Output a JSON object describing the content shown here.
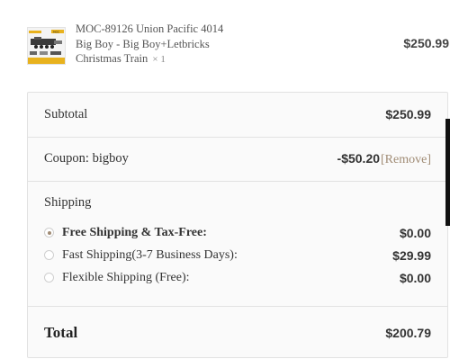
{
  "product": {
    "name_line1": "MOC-89126 Union Pacific 4014",
    "name_line2": "Big Boy - Big Boy+Letbricks",
    "name_line3": "Christmas Train",
    "quantity": "× 1",
    "price": "$250.99",
    "thumbnail_icon": "train-product-image"
  },
  "summary": {
    "subtotal_label": "Subtotal",
    "subtotal_value": "$250.99",
    "coupon_label": "Coupon: bigboy",
    "coupon_value": "-$50.20",
    "coupon_remove": "[Remove]",
    "shipping_label": "Shipping",
    "shipping_options": [
      {
        "label": "Free Shipping & Tax-Free:",
        "price": "$0.00",
        "selected": true
      },
      {
        "label": "Fast Shipping(3-7 Business Days):",
        "price": "$29.99",
        "selected": false
      },
      {
        "label": "Flexible Shipping (Free):",
        "price": "$0.00",
        "selected": false
      }
    ],
    "total_label": "Total",
    "total_value": "$200.79"
  },
  "colors": {
    "accent": "#a08b74",
    "panel_bg": "#fafafa",
    "border": "#e2e2e2"
  }
}
